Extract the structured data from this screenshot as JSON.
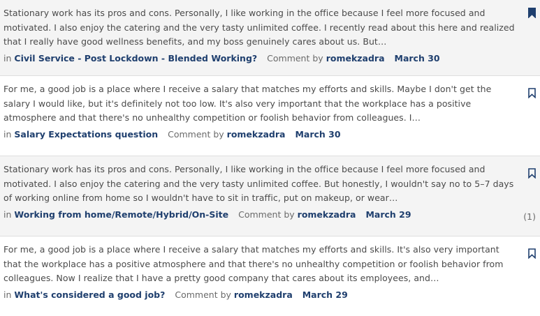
{
  "colors": {
    "link": "#1f3f6e",
    "text": "#4a4a4a",
    "muted": "#6a6a6a",
    "alt_row_bg": "#f4f4f4"
  },
  "comments": [
    {
      "excerpt": "Stationary work has its pros and cons. Personally, I like working in the office because I feel more focused and motivated. I also enjoy the catering and the very tasty unlimited coffee. I recently read about this here and realized that I really have good wellness benefits, and my boss genuinely cares about us. But…",
      "in_label": "in",
      "thread": "Civil Service - Post Lockdown - Blended Working?",
      "comment_by_label": "Comment by",
      "author": "romekzadra",
      "date": "March 30",
      "bookmark_icon": "bookmark-filled-icon",
      "bookmarked": true,
      "reply_count": ""
    },
    {
      "excerpt": "For me, a good job is a place where I receive a salary that matches my efforts and skills. Maybe I don't get the salary I would like, but it's definitely not too low. It's also very important that the workplace has a positive atmosphere and that there's no unhealthy competition or foolish behavior from colleagues. I…",
      "in_label": "in",
      "thread": "Salary Expectations question",
      "comment_by_label": "Comment by",
      "author": "romekzadra",
      "date": "March 30",
      "bookmark_icon": "bookmark-outline-icon",
      "bookmarked": false,
      "reply_count": ""
    },
    {
      "excerpt": "Stationary work has its pros and cons. Personally, I like working in the office because I feel more focused and motivated. I also enjoy the catering and the very tasty unlimited coffee. But honestly, I wouldn't say no to 5–7 days of working online from home so I wouldn't have to sit in traffic, put on makeup, or wear…",
      "in_label": "in",
      "thread": "Working from home/Remote/Hybrid/On-Site",
      "comment_by_label": "Comment by",
      "author": "romekzadra",
      "date": "March 29",
      "bookmark_icon": "bookmark-outline-icon",
      "bookmarked": false,
      "reply_count": "(1)"
    },
    {
      "excerpt": "For me, a good job is a place where I receive a salary that matches my efforts and skills. It's also very important that the workplace has a positive atmosphere and that there's no unhealthy competition or foolish behavior from colleagues. Now I realize that I have a pretty good company that cares about its employees, and…",
      "in_label": "in",
      "thread": "What's considered a good job?",
      "comment_by_label": "Comment by",
      "author": "romekzadra",
      "date": "March 29",
      "bookmark_icon": "bookmark-outline-icon",
      "bookmarked": false,
      "reply_count": ""
    }
  ]
}
